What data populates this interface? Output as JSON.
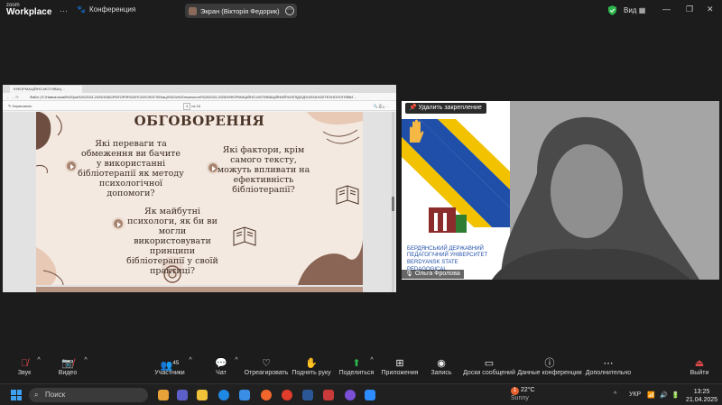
{
  "app": {
    "logo_line1": "zoom",
    "logo_line2": "Workplace",
    "menu_dots": "⋯",
    "conference_label": "Конференция",
    "screen_share_label": "Экран (Вікторія Федорик)",
    "view_label": "Вид"
  },
  "browser": {
    "tab_title": "ІНФОРМАЦІЙНО-МОТИВАЦ…",
    "address": "Файл | E:/Навчальний%20рік%202024-2025/ЛАБОРАТОРІЯ%20ПСИХОЛОГІЇ/Лекції%20з%20психології%202024-2025/ІНФОРМАЦІЙНО-МОТИВАЦІЙНИЙ%20ПІДХІД%20ЗА%20ТЕХНОЛОГІЯМИ…",
    "pdf_toolbar_left": "Нарисовать",
    "pdf_page_current": "4",
    "pdf_page_total": "из 16"
  },
  "slide": {
    "title": "ОБГОВОРЕННЯ",
    "q1": "Які переваги та обмеження ви бачите у використанні бібліотерапії як методу психологічної допомоги?",
    "q2": "Які фактори, крім самого тексту, можуть впливати на ефективність бібліотерапії?",
    "q3": "Як майбутні психологи, як би ви могли використовувати принципи бібліотерапії у своїй практиці?",
    "accent_color": "#a88470",
    "background_color": "#f4e9e0"
  },
  "speaker": {
    "unpin_label": "Удалить закрепление",
    "name": "Ольга Фролова",
    "background_text_1": "БЕРДЯНСЬКИЙ ДЕРЖАВНИЙ",
    "background_text_2": "ПЕДАГОГІЧНИЙ УНІВЕРСИТЕТ",
    "background_text_3": "BERDYANSK STATE",
    "background_text_4": "PEDAGOGICAL"
  },
  "toolbar": {
    "audio": "Звук",
    "video": "Видео",
    "participants": "Участники",
    "participants_count": "45",
    "chat": "Чат",
    "react": "Отреагировать",
    "raise_hand": "Поднять руку",
    "share": "Поделиться",
    "apps": "Приложения",
    "record": "Запись",
    "whiteboards": "Доски сообщений",
    "meeting_info": "Данные конференции",
    "more": "Дополнительно",
    "leave": "Выйти"
  },
  "taskbar": {
    "search_placeholder": "Поиск",
    "weather_temp": "22°C",
    "weather_desc": "Sunny",
    "language": "УКР",
    "time": "13:25",
    "date": "21.04.2025",
    "badge_count": "1"
  }
}
